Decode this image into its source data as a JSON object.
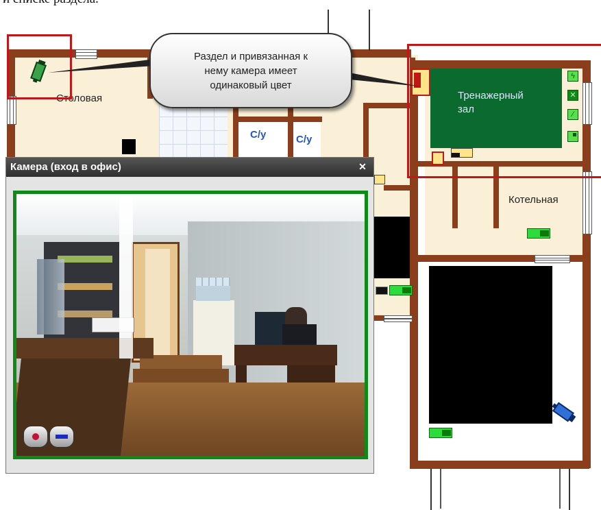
{
  "top_caption": "и списке раздела.",
  "callout": {
    "line1": "Раздел и привязанная к",
    "line2": "нему камера имеет",
    "line3": "одинаковый цвет"
  },
  "rooms": {
    "canteen": "Столовая",
    "wc1": "С/у",
    "wc2": "С/у",
    "gym_line1": "Тренажерный",
    "gym_line2": "зал",
    "boiler": "Котельная"
  },
  "camera_window": {
    "title": "Камера (вход в офис)",
    "close_symbol": "✕",
    "record_button": "record",
    "stop_button": "stop"
  },
  "colors": {
    "wall": "#8a3e1c",
    "floor": "#faf0d8",
    "gym_zone": "#0b6b2e",
    "highlight": "#c01818",
    "indicator": "#2bdc3c",
    "window_title_bg": "#3a3a3a",
    "frame_border": "#0f8a18"
  },
  "icons": {
    "canteen_camera": "camera-icon",
    "gym_camera": "camera-icon",
    "gym_sensors": [
      "lightning-icon",
      "x-box-icon",
      "slash-box-icon",
      "corner-box-icon"
    ],
    "corner_camera": "camera-icon"
  }
}
